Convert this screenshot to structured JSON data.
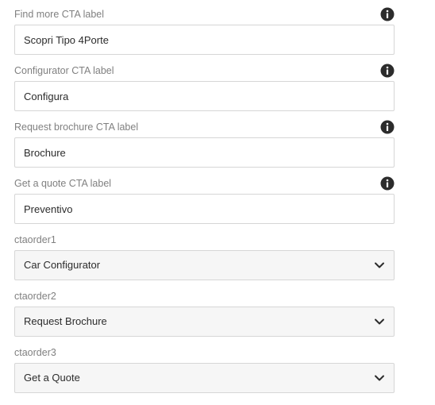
{
  "fields": [
    {
      "label": "Find more CTA label",
      "value": "Scopri Tipo 4Porte",
      "type": "text",
      "icon": "info-icon"
    },
    {
      "label": "Configurator CTA label",
      "value": "Configura",
      "type": "text",
      "icon": "info-icon"
    },
    {
      "label": "Request brochure CTA label",
      "value": "Brochure",
      "type": "text",
      "icon": "info-icon"
    },
    {
      "label": "Get a quote CTA label",
      "value": "Preventivo",
      "type": "text",
      "icon": "info-icon"
    },
    {
      "label": "ctaorder1",
      "value": "Car Configurator",
      "type": "select",
      "icon": "chevron-down-icon"
    },
    {
      "label": "ctaorder2",
      "value": "Request Brochure",
      "type": "select",
      "icon": "chevron-down-icon"
    },
    {
      "label": "ctaorder3",
      "value": "Get a Quote",
      "type": "select",
      "icon": "chevron-down-icon"
    }
  ],
  "colors": {
    "label": "#808080",
    "border": "#d6d6d6",
    "select_bg": "#f6f6f6",
    "icon": "#2c2c2c"
  }
}
